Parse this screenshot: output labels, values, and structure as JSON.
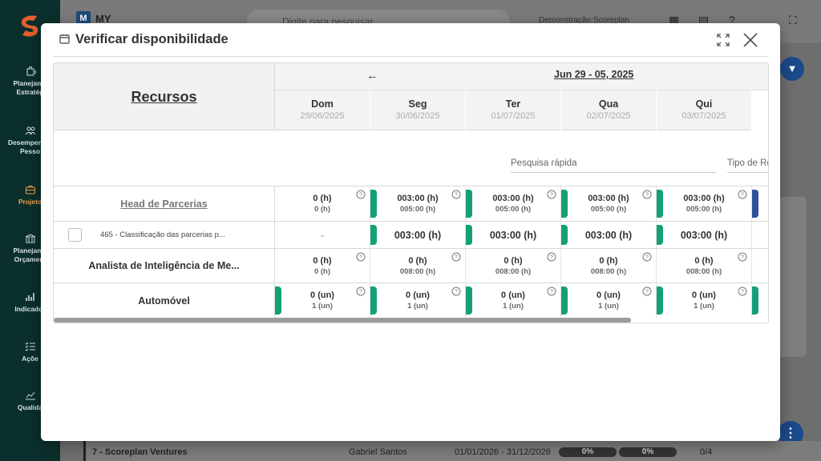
{
  "sidebar": {
    "items": [
      {
        "label": "Planejame Estratég",
        "icon": "puzzle-icon"
      },
      {
        "label": "Desempen de Pesso",
        "icon": "people-icon"
      },
      {
        "label": "Projeto",
        "icon": "briefcase-icon"
      },
      {
        "label": "Planejame Orçament",
        "icon": "bank-icon"
      },
      {
        "label": "Indicador",
        "icon": "bar-chart-icon"
      },
      {
        "label": "Açõe",
        "icon": "checklist-icon"
      },
      {
        "label": "Qualida",
        "icon": "line-chart-icon"
      }
    ]
  },
  "topbar": {
    "brand": "MY",
    "search_placeholder": "Digite para pesquisar",
    "demo": "Demonstração Scoreplan"
  },
  "background_row": {
    "project": "7 - Scoreplan Ventures",
    "owner": "Gabriel Santos",
    "dates": "01/01/2026 - 31/12/2026",
    "progress1": "0%",
    "progress2": "0%",
    "count": "0/4"
  },
  "modal": {
    "title": "Verificar disponibilidade",
    "resources_header": "Recursos",
    "date_range": "Jun 29 - 05, 2025",
    "days": [
      {
        "name": "Dom",
        "date": "29/06/2025"
      },
      {
        "name": "Seg",
        "date": "30/06/2025"
      },
      {
        "name": "Ter",
        "date": "01/07/2025"
      },
      {
        "name": "Qua",
        "date": "02/07/2025"
      },
      {
        "name": "Qui",
        "date": "03/07/2025"
      }
    ],
    "filters": {
      "quick_search": "Pesquisa rápida",
      "type": "Tipo de Re"
    },
    "rows": [
      {
        "label": "Head de Parcerias",
        "cells": [
          {
            "v1": "0 (h)",
            "v2": "0 (h)"
          },
          {
            "v1": "003:00 (h)",
            "v2": "005:00 (h)"
          },
          {
            "v1": "003:00 (h)",
            "v2": "005:00 (h)"
          },
          {
            "v1": "003:00 (h)",
            "v2": "005:00 (h)"
          },
          {
            "v1": "003:00 (h)",
            "v2": "005:00 (h)"
          }
        ]
      },
      {
        "label": "465 - Classificação das parcerias p...",
        "cells": [
          {
            "v1": "-"
          },
          {
            "v1": "003:00 (h)"
          },
          {
            "v1": "003:00 (h)"
          },
          {
            "v1": "003:00 (h)"
          },
          {
            "v1": "003:00 (h)"
          }
        ]
      },
      {
        "label": "Analista de Inteligência de Me...",
        "cells": [
          {
            "v1": "0 (h)",
            "v2": "0 (h)"
          },
          {
            "v1": "0 (h)",
            "v2": "008:00 (h)"
          },
          {
            "v1": "0 (h)",
            "v2": "008:00 (h)"
          },
          {
            "v1": "0 (h)",
            "v2": "008:00 (h)"
          },
          {
            "v1": "0 (h)",
            "v2": "008:00 (h)"
          }
        ]
      },
      {
        "label": "Automóvel",
        "cells": [
          {
            "v1": "0 (un)",
            "v2": "1 (un)"
          },
          {
            "v1": "0 (un)",
            "v2": "1 (un)"
          },
          {
            "v1": "0 (un)",
            "v2": "1 (un)"
          },
          {
            "v1": "0 (un)",
            "v2": "1 (un)"
          },
          {
            "v1": "0 (un)",
            "v2": "1 (un)"
          }
        ]
      }
    ]
  },
  "colors": {
    "sidebar_bg": "#0b2f2c",
    "accent_green": "#14a077",
    "accent_blue": "#2d4f9c",
    "active_nav": "#f0a04b"
  }
}
